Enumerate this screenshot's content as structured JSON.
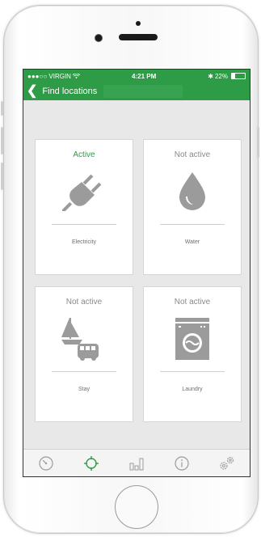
{
  "status_bar": {
    "carrier": "●●●○○ VIRGIN",
    "time": "4:21 PM",
    "battery": "22%",
    "battery_level": 0.22
  },
  "navbar": {
    "back_label": "Find locations"
  },
  "tiles": [
    {
      "status": "Active",
      "label": "Electricity",
      "icon": "plug-icon",
      "active": true
    },
    {
      "status": "Not active",
      "label": "Water",
      "icon": "water-drop-icon",
      "active": false
    },
    {
      "status": "Not active",
      "label": "Stay",
      "icon": "boat-van-icon",
      "active": false
    },
    {
      "status": "Not active",
      "label": "Laundry",
      "icon": "washing-machine-icon",
      "active": false
    }
  ],
  "tabs": [
    {
      "icon": "gauge-icon",
      "selected": false
    },
    {
      "icon": "crosshair-icon",
      "selected": true
    },
    {
      "icon": "bar-chart-icon",
      "selected": false
    },
    {
      "icon": "info-icon",
      "selected": false
    },
    {
      "icon": "settings-gears-icon",
      "selected": false
    }
  ],
  "colors": {
    "accent": "#2e9b46",
    "inactive_text": "#8a8a8a",
    "icon_gray": "#9b9b9b"
  }
}
